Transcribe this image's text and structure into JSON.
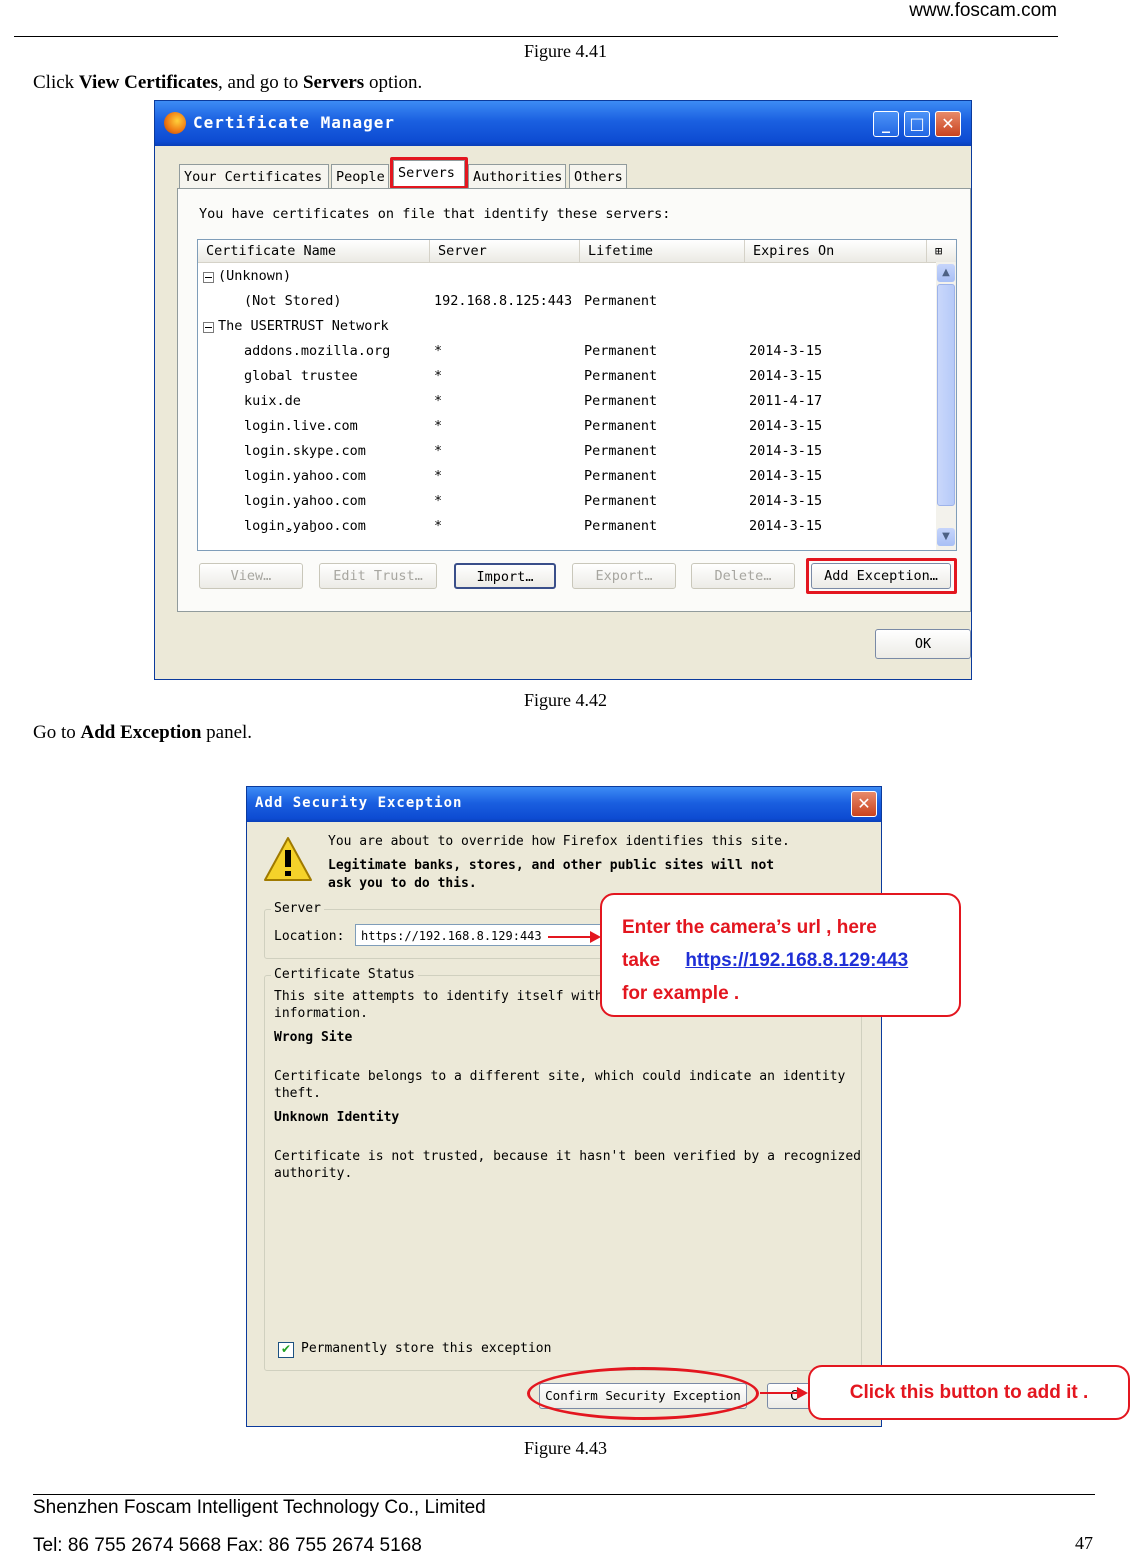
{
  "header": {
    "website": "www.foscam.com"
  },
  "fig41": {
    "caption": "Figure 4.41"
  },
  "instruction1": {
    "prefix": "Click ",
    "bold1": "View Certificates",
    "middle": ", and go to ",
    "bold2": "Servers",
    "suffix": " option."
  },
  "cert_manager": {
    "title": "Certificate Manager",
    "tabs": [
      "Your Certificates",
      "People",
      "Servers",
      "Authorities",
      "Others"
    ],
    "active_tab": "Servers",
    "description": "You have certificates on file that identify these servers:",
    "columns": [
      "Certificate Name",
      "Server",
      "Lifetime",
      "Expires On"
    ],
    "groups": [
      {
        "name": "(Unknown)",
        "rows": [
          {
            "name": "(Not Stored)",
            "server": "192.168.8.125:443",
            "lifetime": "Permanent",
            "expires": ""
          }
        ]
      },
      {
        "name": "The USERTRUST Network",
        "rows": [
          {
            "name": "addons.mozilla.org",
            "server": "*",
            "lifetime": "Permanent",
            "expires": "2014-3-15"
          },
          {
            "name": "global trustee",
            "server": "*",
            "lifetime": "Permanent",
            "expires": "2014-3-15"
          },
          {
            "name": "kuix.de",
            "server": "*",
            "lifetime": "Permanent",
            "expires": "2011-4-17"
          },
          {
            "name": "login.live.com",
            "server": "*",
            "lifetime": "Permanent",
            "expires": "2014-3-15"
          },
          {
            "name": "login.skype.com",
            "server": "*",
            "lifetime": "Permanent",
            "expires": "2014-3-15"
          },
          {
            "name": "login.yahoo.com",
            "server": "*",
            "lifetime": "Permanent",
            "expires": "2014-3-15"
          },
          {
            "name": "login.yahoo.com",
            "server": "*",
            "lifetime": "Permanent",
            "expires": "2014-3-15"
          },
          {
            "name": "login.yahoo.com",
            "server": "*",
            "lifetime": "Permanent",
            "expires": "2014-3-15"
          }
        ]
      }
    ],
    "buttons": {
      "view": "View…",
      "edit_trust": "Edit Trust…",
      "import": "Import…",
      "export": "Export…",
      "delete": "Delete…",
      "add_exception": "Add Exception…",
      "ok": "OK"
    }
  },
  "fig42": {
    "caption": "Figure 4.42"
  },
  "instruction2": {
    "prefix": "Go to ",
    "bold": "Add Exception",
    "suffix": " panel."
  },
  "add_exception": {
    "title": "Add Security Exception",
    "warning_line1": "You are about to override how Firefox identifies this site.",
    "warning_line2": "Legitimate banks, stores, and other public sites will not",
    "warning_line3": "ask you to do this.",
    "server_group": "Server",
    "location_label": "Location:",
    "location_value": "https://192.168.8.129:443",
    "status_group": "Certificate Status",
    "status_line1": "This site attempts to identify itself with",
    "status_line2": "information.",
    "wrong_site": "Wrong Site",
    "wrong_site_desc1": "Certificate belongs to a different site, which could indicate an identity",
    "wrong_site_desc2": "theft.",
    "unknown_identity": "Unknown Identity",
    "unknown_desc1": "Certificate is not trusted, because it hasn't been verified by a recognized",
    "unknown_desc2": "authority.",
    "permanent_label": "Permanently store this exception",
    "permanent_checked": true,
    "confirm_button": "Confirm Security Exception",
    "cancel_button_partial": "C"
  },
  "callouts": {
    "url_line1": "Enter  the  camera’s  url  ,  here",
    "url_take": "take",
    "url_link": "https://192.168.8.129:443",
    "url_line3": "for example .",
    "click_button": "Click this button to add it ."
  },
  "fig43": {
    "caption": "Figure 4.43"
  },
  "footer": {
    "company": "Shenzhen Foscam Intelligent Technology Co., Limited",
    "contact": "Tel: 86 755 2674 5668 Fax: 86 755 2674 5168",
    "page_number": "47"
  },
  "colors": {
    "callout_red": "#e3161f",
    "link_blue": "#1f2fd6",
    "titlebar_blue": "#0d4bd2"
  }
}
